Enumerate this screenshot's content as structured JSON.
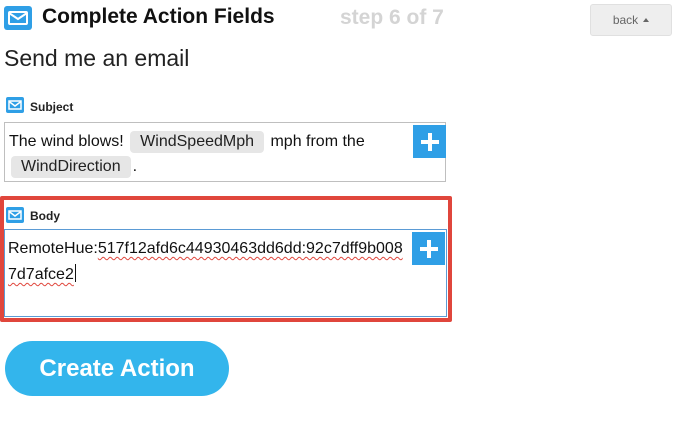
{
  "header": {
    "title": "Complete Action Fields",
    "step": "step 6 of 7",
    "back_label": "back"
  },
  "action_name": "Send me an email",
  "subject": {
    "label": "Subject",
    "text_before": "The wind blows! ",
    "ingredient_1": "WindSpeedMph",
    "text_middle": " mph from the ",
    "ingredient_2": "WindDirection",
    "text_after": "."
  },
  "body": {
    "label": "Body",
    "prefix": "RemoteHue:",
    "value": "517f12afd6c44930463dd6dd:92c7dff9b0087d7afce2"
  },
  "create_button_label": "Create Action",
  "colors": {
    "accent_blue": "#2f9fe6",
    "create_button": "#33b5ec",
    "highlight_border": "#e0463c",
    "step_text": "#d4d4d4"
  },
  "icons": {
    "header": "mail-icon",
    "subject": "mail-icon",
    "body": "mail-icon",
    "add_ingredient": "plus-icon",
    "back_caret": "caret-up-icon"
  }
}
